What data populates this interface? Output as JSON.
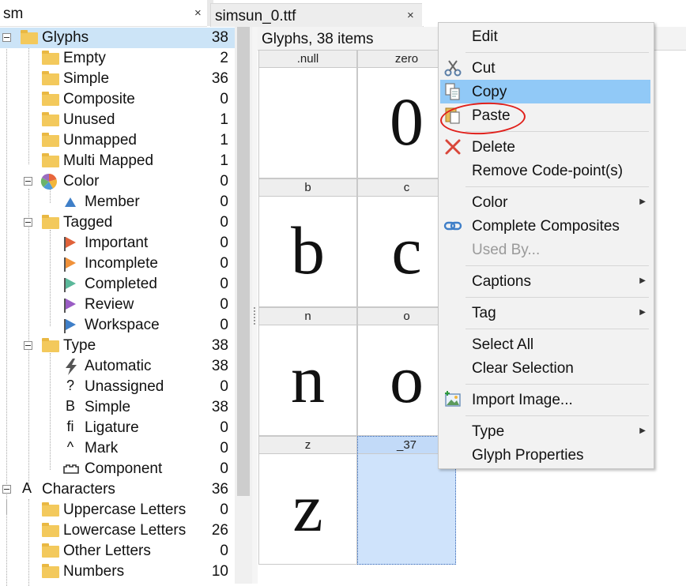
{
  "tabs": {
    "search_value": "sm",
    "close": "×",
    "file_tab": "simsun_0.ttf"
  },
  "tree": {
    "rows": [
      {
        "label": "Glyphs",
        "count": "38"
      },
      {
        "label": "Empty",
        "count": "2"
      },
      {
        "label": "Simple",
        "count": "36"
      },
      {
        "label": "Composite",
        "count": "0"
      },
      {
        "label": "Unused",
        "count": "1"
      },
      {
        "label": "Unmapped",
        "count": "1"
      },
      {
        "label": "Multi Mapped",
        "count": "1"
      },
      {
        "label": "Color",
        "count": "0"
      },
      {
        "label": "Member",
        "count": "0"
      },
      {
        "label": "Tagged",
        "count": "0"
      },
      {
        "label": "Important",
        "count": "0"
      },
      {
        "label": "Incomplete",
        "count": "0"
      },
      {
        "label": "Completed",
        "count": "0"
      },
      {
        "label": "Review",
        "count": "0"
      },
      {
        "label": "Workspace",
        "count": "0"
      },
      {
        "label": "Type",
        "count": "38"
      },
      {
        "label": "Automatic",
        "count": "38"
      },
      {
        "label": "Unassigned",
        "count": "0"
      },
      {
        "label": "Simple",
        "count": "38"
      },
      {
        "label": "Ligature",
        "count": "0"
      },
      {
        "label": "Mark",
        "count": "0"
      },
      {
        "label": "Component",
        "count": "0"
      },
      {
        "label": "Characters",
        "count": "36"
      },
      {
        "label": "Uppercase Letters",
        "count": "0"
      },
      {
        "label": "Lowercase Letters",
        "count": "26"
      },
      {
        "label": "Other Letters",
        "count": "0"
      },
      {
        "label": "Numbers",
        "count": "10"
      }
    ],
    "type_glyphs": {
      "unassigned": "?",
      "simple": "B",
      "ligature": "fi",
      "mark": "^",
      "characters": "A"
    },
    "flag_colors": {
      "important": "#e0623a",
      "incomplete": "#f0913a",
      "completed": "#5bb89a",
      "review": "#9a5cc4",
      "workspace": "#3f7fc8"
    }
  },
  "grid": {
    "header": "Glyphs, 38 items",
    "cells": [
      {
        "name": ".null",
        "glyph": ""
      },
      {
        "name": "zero",
        "glyph": "0"
      },
      {
        "name": "b",
        "glyph": "b"
      },
      {
        "name": "c",
        "glyph": "c"
      },
      {
        "name": "n",
        "glyph": "n"
      },
      {
        "name": "o",
        "glyph": "o"
      },
      {
        "name": "z",
        "glyph": "z"
      },
      {
        "name": "_37",
        "glyph": ""
      }
    ]
  },
  "context_menu": {
    "edit": "Edit",
    "cut": "Cut",
    "copy": "Copy",
    "paste": "Paste",
    "delete": "Delete",
    "remove_codepoints": "Remove Code-point(s)",
    "color": "Color",
    "complete_composites": "Complete Composites",
    "used_by": "Used By...",
    "captions": "Captions",
    "tag": "Tag",
    "select_all": "Select All",
    "clear_selection": "Clear Selection",
    "import_image": "Import Image...",
    "type": "Type",
    "glyph_properties": "Glyph Properties",
    "highlight_color": "#91c9f7",
    "annotation_color": "#e0201b"
  }
}
